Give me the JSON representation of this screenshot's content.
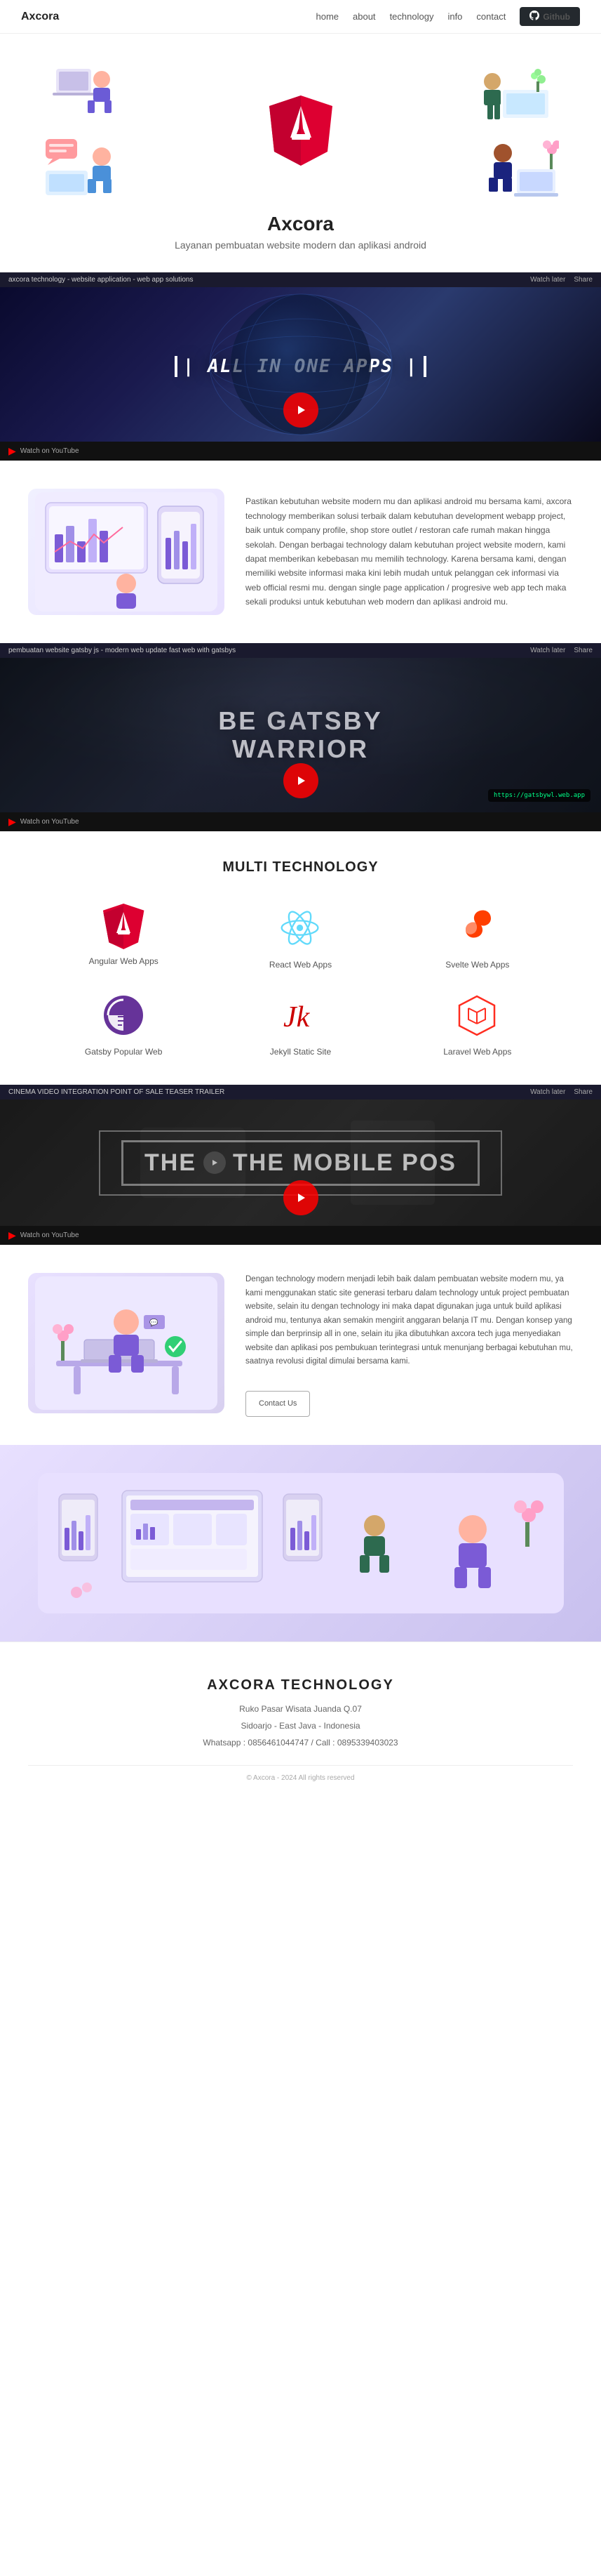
{
  "navbar": {
    "brand": "Axcora",
    "links": [
      "home",
      "about",
      "technology",
      "info",
      "contact"
    ],
    "github_label": "Github"
  },
  "hero": {
    "title": "Axcora",
    "subtitle": "Layanan pembuatan website modern dan aplikasi android"
  },
  "video1": {
    "bar_text": "axcora technology - website application - web app solutions",
    "watch_later": "Watch later",
    "share": "Share",
    "overlay_text": "| ALL IN ONE APPS |",
    "youtube_label": "Watch on YouTube"
  },
  "desc1": {
    "text": "Pastikan kebutuhan website modern mu dan aplikasi android mu bersama kami, axcora technology memberikan solusi terbaik dalam kebutuhan development webapp project, baik untuk company profile, shop store outlet / restoran cafe rumah makan hingga sekolah. Dengan berbagai technology dalam kebutuhan project website modern, kami dapat memberikan kebebasan mu memilih technology. Karena bersama kami, dengan memiliki website informasi maka kini lebih mudah untuk pelanggan cek informasi via web official resmi mu. dengan single page application / progresive web app tech maka sekali produksi untuk kebutuhan web modern dan aplikasi android mu."
  },
  "video2": {
    "bar_text": "pembuatan website gatsby js - modern web update fast web with gatsbys",
    "watch_later": "Watch later",
    "share": "Share",
    "overlay_line1": "BE GATSBY",
    "overlay_line2": "WARRIOR",
    "badge_text": "https://gatsbywl.web.app",
    "youtube_label": "Watch on YouTube"
  },
  "tech_section": {
    "title": "MULTI TECHNOLOGY",
    "items": [
      {
        "id": "angular",
        "label": "Angular Web Apps",
        "type": "angular"
      },
      {
        "id": "react",
        "label": "React Web Apps",
        "type": "react"
      },
      {
        "id": "svelte",
        "label": "Svelte Web Apps",
        "type": "svelte"
      },
      {
        "id": "gatsby",
        "label": "Gatsby Popular Web",
        "type": "gatsby"
      },
      {
        "id": "jekyll",
        "label": "Jekyll Static Site",
        "type": "jekyll"
      },
      {
        "id": "laravel",
        "label": "Laravel Web Apps",
        "type": "laravel"
      }
    ]
  },
  "video3": {
    "bar_text": "CINEMA VIDEO INTEGRATION POINT OF SALE TEASER TRAILER",
    "watch_later": "Watch later",
    "share": "Share",
    "overlay_text": "THE MOBILE POS",
    "youtube_label": "Watch on YouTube"
  },
  "desc2": {
    "text": "Dengan technology modern menjadi lebih baik dalam pembuatan website modern mu, ya kami menggunakan static site generasi terbaru dalam technology untuk project pembuatan website, selain itu dengan technology ini maka dapat digunakan juga untuk build aplikasi android mu, tentunya akan semakin mengirit anggaran belanja IT mu. Dengan konsep yang simple dan berprinsip all in one, selain itu jika dibutuhkan axcora tech juga menyediakan website dan aplikasi pos pembukuan terintegrasi untuk menunjang berbagai kebutuhan mu, saatnya revolusi digital dimulai bersama kami.",
    "contact_label": "Contact Us"
  },
  "footer": {
    "title": "AXCORA TECHNOLOGY",
    "address_line1": "Ruko Pasar Wisata Juanda Q.07",
    "address_line2": "Sidoarjo - East Java - Indonesia",
    "contact_line1": "Whatsapp : 0856461044747 / Call : 0895339403023",
    "copyright": "© Axcora - 2024 All rights reserved"
  }
}
